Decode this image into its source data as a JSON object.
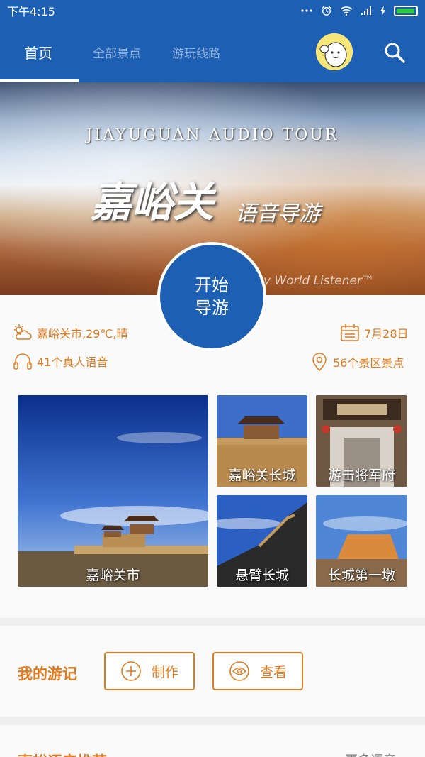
{
  "status_bar": {
    "time": "下午4:15"
  },
  "nav": {
    "tabs": [
      {
        "label": "首页",
        "active": true
      },
      {
        "label": "全部景点",
        "active": false
      },
      {
        "label": "游玩线路",
        "active": false
      }
    ],
    "search_icon": "search-icon"
  },
  "hero": {
    "en_title": "JIAYUGUAN AUDIO TOUR",
    "cn_title": "嘉峪关",
    "cn_subtitle": "语音导游",
    "credit": "y World Listener™"
  },
  "start_button": {
    "line1": "开始",
    "line2": "导游"
  },
  "info": {
    "weather": "嘉峪关市,29℃,晴",
    "date": "7月28日",
    "voices": "41个真人语音",
    "spots": "56个景区景点"
  },
  "tiles": [
    {
      "label": "嘉峪关市"
    },
    {
      "label": "嘉峪关长城"
    },
    {
      "label": "游击将军府"
    },
    {
      "label": "悬臂长城"
    },
    {
      "label": "长城第一墩"
    }
  ],
  "journal": {
    "title": "我的游记",
    "create_label": "制作",
    "view_label": "查看"
  },
  "next_section": {
    "left": "嘉峪语音推荐",
    "right": "更多语音"
  },
  "colors": {
    "primary": "#1d5fb3",
    "accent": "#e07b1f"
  }
}
